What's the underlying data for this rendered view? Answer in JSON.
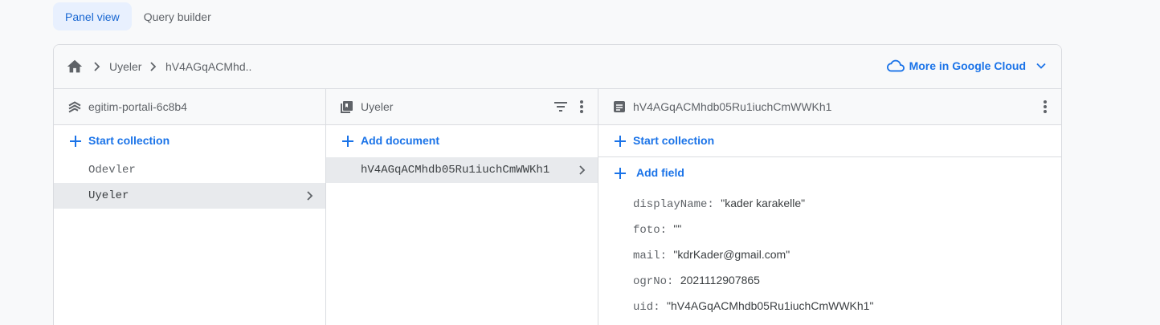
{
  "tabs": [
    {
      "label": "Panel view",
      "active": true
    },
    {
      "label": "Query builder",
      "active": false
    }
  ],
  "breadcrumb": {
    "items": [
      "Uyeler",
      "hV4AGqACMhd.."
    ],
    "google_cloud_label": "More in Google Cloud"
  },
  "columns": {
    "root": {
      "title": "egitim-portali-6c8b4",
      "action_label": "Start collection",
      "items": [
        {
          "label": "Odevler",
          "selected": false
        },
        {
          "label": "Uyeler",
          "selected": true
        }
      ]
    },
    "collection": {
      "title": "Uyeler",
      "action_label": "Add document",
      "items": [
        {
          "label": "hV4AGqACMhdb05Ru1iuchCmWWKh1",
          "selected": true
        }
      ]
    },
    "document": {
      "title": "hV4AGqACMhdb05Ru1iuchCmWWKh1",
      "start_collection_label": "Start collection",
      "add_field_label": "Add field",
      "fields": [
        {
          "key": "displayName",
          "value": "\"kader karakelle\""
        },
        {
          "key": "foto",
          "value": "\"\""
        },
        {
          "key": "mail",
          "value": "\"kdrKader@gmail.com\""
        },
        {
          "key": "ogrNo",
          "value": "2021112907865"
        },
        {
          "key": "uid",
          "value": "\"hV4AGqACMhdb05Ru1iuchCmWWKh1\""
        }
      ]
    }
  },
  "colors": {
    "accent": "#1a73e8",
    "selected_row": "#e8eaed",
    "active_tab_bg": "#e8f0fe"
  },
  "icons": {
    "home": "home-icon",
    "database": "firestore-database-icon",
    "collection": "collection-icon",
    "document": "document-icon",
    "filter": "filter-icon",
    "more": "more-vert-icon",
    "cloud": "cloud-icon",
    "chevron": "chevron-right-icon",
    "add": "plus-icon"
  }
}
